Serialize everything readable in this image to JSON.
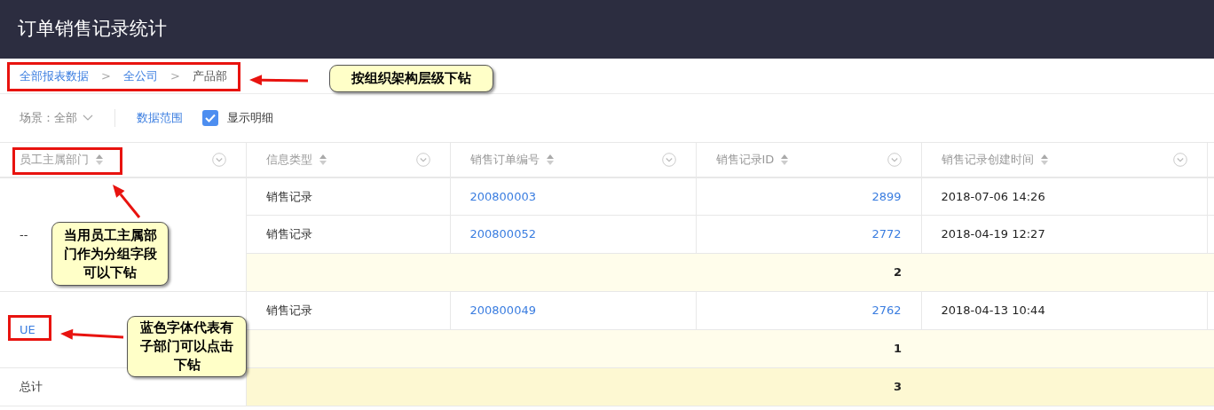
{
  "header": {
    "title": "订单销售记录统计"
  },
  "breadcrumb": {
    "separator": ">",
    "items": [
      {
        "label": "全部报表数据",
        "link": true
      },
      {
        "label": "全公司",
        "link": true
      },
      {
        "label": "产品部",
        "link": false
      }
    ]
  },
  "toolbar": {
    "scene": "场景：全部",
    "data_range": "数据范围",
    "show_detail": {
      "label": "显示明细",
      "checked": true
    }
  },
  "table": {
    "columns": [
      "员工主属部门",
      "信息类型",
      "销售订单编号",
      "销售记录ID",
      "销售记录创建时间"
    ],
    "groups": [
      {
        "department": "--",
        "link": false,
        "rows": [
          {
            "type": "销售记录",
            "order_no": "200800003",
            "record_id": "2899",
            "created": "2018-07-06 14:26"
          },
          {
            "type": "销售记录",
            "order_no": "200800052",
            "record_id": "2772",
            "created": "2018-04-19 12:27"
          }
        ],
        "subtotal": "2"
      },
      {
        "department": "UE",
        "link": true,
        "rows": [
          {
            "type": "销售记录",
            "order_no": "200800049",
            "record_id": "2762",
            "created": "2018-04-13 10:44"
          }
        ],
        "subtotal": "1"
      }
    ],
    "total": {
      "label": "总计",
      "value": "3"
    }
  },
  "annotations": [
    {
      "text": "按组织架构层级下钻"
    },
    {
      "text": "当用员工主属部门作为分组字段可以下钻"
    },
    {
      "text": "蓝色字体代表有子部门可以点击下钻"
    }
  ]
}
